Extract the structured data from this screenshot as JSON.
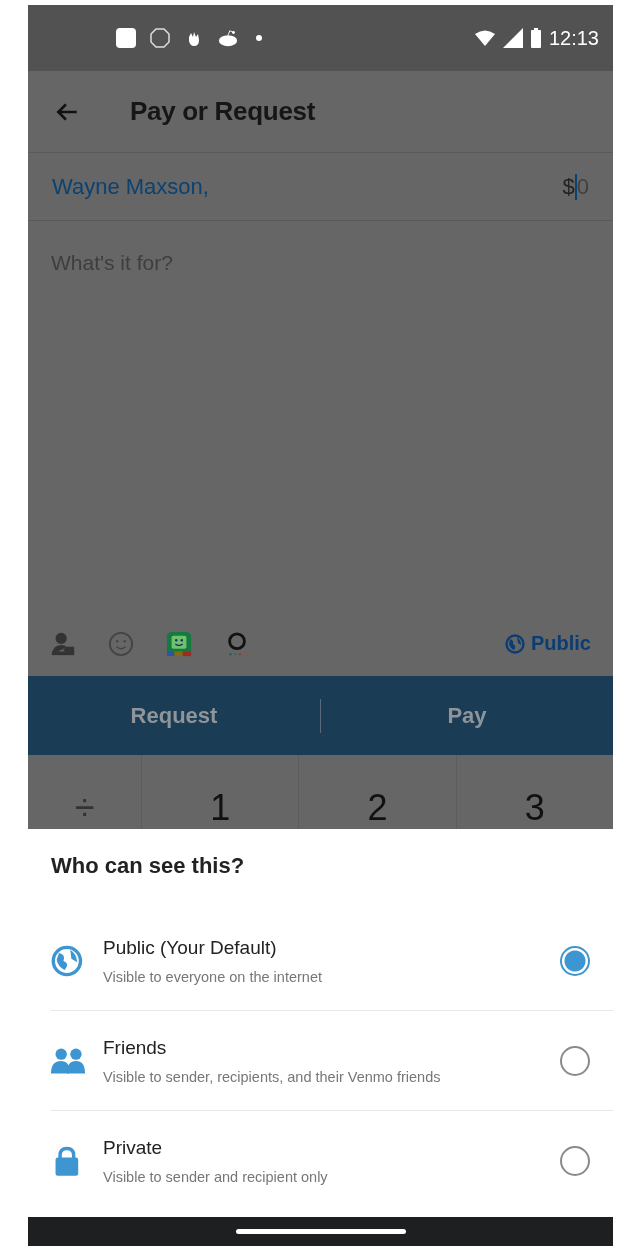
{
  "status_bar": {
    "time": "12:13"
  },
  "app_bar": {
    "title": "Pay or Request"
  },
  "recipient": {
    "name": "Wayne Maxson,"
  },
  "amount": {
    "prefix": "$",
    "placeholder": "0"
  },
  "note": {
    "placeholder": "What's it for?"
  },
  "audience_button": {
    "label": "Public"
  },
  "actions": [
    {
      "label": "Request"
    },
    {
      "label": "Pay"
    }
  ],
  "keypad": [
    "÷",
    "1",
    "2",
    "3"
  ],
  "sheet": {
    "title": "Who can see this?",
    "options": [
      {
        "title": "Public (Your Default)",
        "subtitle": "Visible to everyone on the internet",
        "selected": true
      },
      {
        "title": "Friends",
        "subtitle": "Visible to sender, recipients, and their Venmo friends",
        "selected": false
      },
      {
        "title": "Private",
        "subtitle": "Visible to sender and recipient only",
        "selected": false
      }
    ]
  }
}
